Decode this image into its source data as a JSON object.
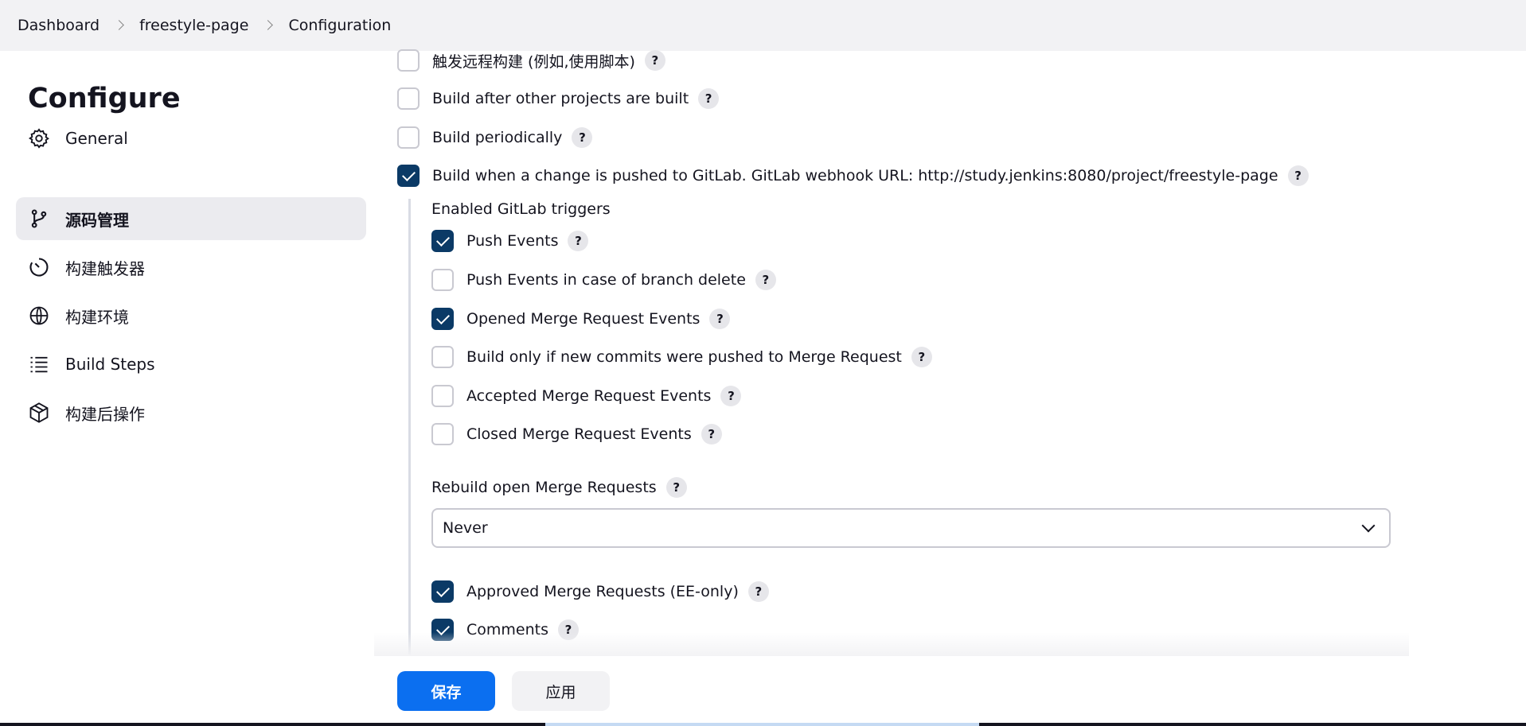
{
  "breadcrumb": {
    "items": [
      "Dashboard",
      "freestyle-page",
      "Configuration"
    ]
  },
  "sidebar": {
    "title": "Configure",
    "items": [
      {
        "label": "General",
        "icon": "gear-icon"
      },
      {
        "label": "源码管理",
        "icon": "branch-icon",
        "active": true
      },
      {
        "label": "构建触发器",
        "icon": "clock-icon"
      },
      {
        "label": "构建环境",
        "icon": "globe-icon"
      },
      {
        "label": "Build Steps",
        "icon": "list-icon"
      },
      {
        "label": "构建后操作",
        "icon": "package-icon"
      }
    ]
  },
  "triggers": {
    "remote": {
      "label": "触发远程构建 (例如,使用脚本)",
      "checked": false
    },
    "after_other": {
      "label": "Build after other projects are built",
      "checked": false
    },
    "periodically": {
      "label": "Build periodically",
      "checked": false
    },
    "gitlab": {
      "label": "Build when a change is pushed to GitLab. GitLab webhook URL: http://study.jenkins:8080/project/freestyle-page",
      "checked": true
    }
  },
  "gitlab_triggers": {
    "section_label": "Enabled GitLab triggers",
    "push_events": {
      "label": "Push Events",
      "checked": true
    },
    "push_branch_delete": {
      "label": "Push Events in case of branch delete",
      "checked": false
    },
    "opened_mr": {
      "label": "Opened Merge Request Events",
      "checked": true
    },
    "new_commits_mr": {
      "label": "Build only if new commits were pushed to Merge Request",
      "checked": false
    },
    "accepted_mr": {
      "label": "Accepted Merge Request Events",
      "checked": false
    },
    "closed_mr": {
      "label": "Closed Merge Request Events",
      "checked": false
    },
    "rebuild_label": "Rebuild open Merge Requests",
    "rebuild_value": "Never",
    "approved_mr": {
      "label": "Approved Merge Requests (EE-only)",
      "checked": true
    },
    "comments": {
      "label": "Comments",
      "checked": true
    }
  },
  "help_symbol": "?",
  "actions": {
    "save_label": "保存",
    "apply_label": "应用"
  },
  "colors": {
    "accent": "#0b6ff0",
    "checkbox_checked": "#0b3a66"
  }
}
